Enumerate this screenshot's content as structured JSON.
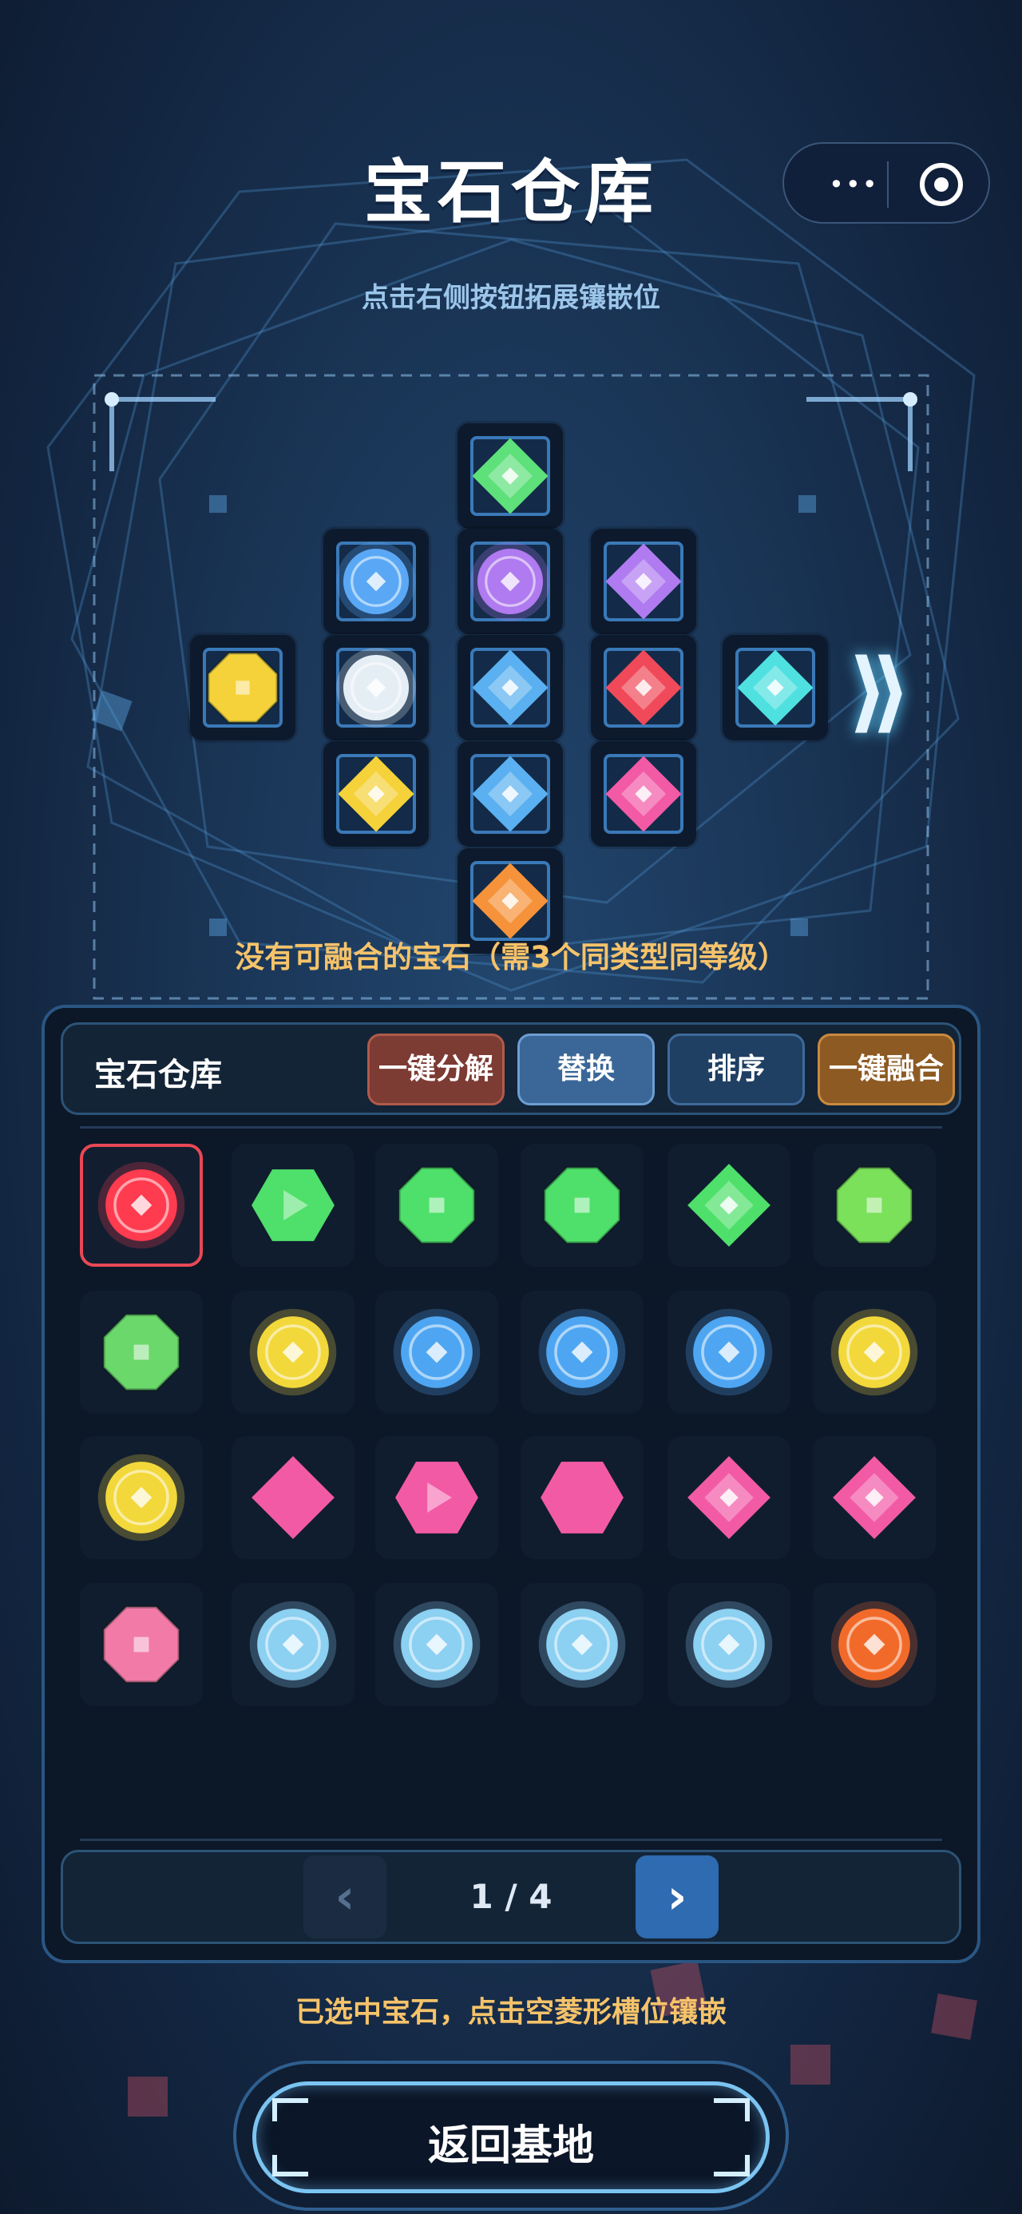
{
  "header": {
    "title": "宝石仓库",
    "menu_icon": "more-dots-icon",
    "close_icon": "target-close-icon"
  },
  "slot_area": {
    "hint": "点击右侧按钮拓展镶嵌位",
    "fusion_message": "没有可融合的宝石（需3个同类型同等级）",
    "expand_icon": "double-chevron-right-icon",
    "slots": [
      {
        "gem": "green-diamond"
      },
      {
        "gem": "blue-orb"
      },
      {
        "gem": "purple-orb"
      },
      {
        "gem": "purple-diamond"
      },
      {
        "gem": "yellow-octagon"
      },
      {
        "gem": "white-orb"
      },
      {
        "gem": "blue-diamond"
      },
      {
        "gem": "red-diamond"
      },
      {
        "gem": "cyan-diamond"
      },
      {
        "gem": "yellow-diamond"
      },
      {
        "gem": "blue-diamond"
      },
      {
        "gem": "pink-diamond"
      },
      {
        "gem": "orange-diamond"
      }
    ]
  },
  "inventory": {
    "title": "宝石仓库",
    "buttons": {
      "decompose": "一键分解",
      "replace": "替换",
      "sort": "排序",
      "fuse": "一键融合"
    },
    "gems": [
      {
        "shape": "orb",
        "color": "#ff3b4f",
        "selected": true
      },
      {
        "shape": "hexagon-play",
        "color": "#4ee06a"
      },
      {
        "shape": "octagon",
        "color": "#4ee06a"
      },
      {
        "shape": "octagon",
        "color": "#4ee06a"
      },
      {
        "shape": "diamond",
        "color": "#4ee06a"
      },
      {
        "shape": "octagon",
        "color": "#7be05a"
      },
      {
        "shape": "octagon",
        "color": "#6ad86a"
      },
      {
        "shape": "orb",
        "color": "#f2d83a"
      },
      {
        "shape": "orb",
        "color": "#4ea6f2"
      },
      {
        "shape": "orb",
        "color": "#4ea6f2"
      },
      {
        "shape": "orb",
        "color": "#4ea6f2"
      },
      {
        "shape": "orb",
        "color": "#f2d83a"
      },
      {
        "shape": "orb",
        "color": "#f2d83a"
      },
      {
        "shape": "diamond-flat",
        "color": "#f25aa6"
      },
      {
        "shape": "hexagon-play",
        "color": "#f25aa6"
      },
      {
        "shape": "hexagon",
        "color": "#f25aa6"
      },
      {
        "shape": "diamond",
        "color": "#f25aa6"
      },
      {
        "shape": "diamond",
        "color": "#f25aa6"
      },
      {
        "shape": "octagon",
        "color": "#f27aa6"
      },
      {
        "shape": "orb",
        "color": "#8cd0f2"
      },
      {
        "shape": "orb",
        "color": "#8cd0f2"
      },
      {
        "shape": "orb",
        "color": "#8cd0f2"
      },
      {
        "shape": "orb",
        "color": "#8cd0f2"
      },
      {
        "shape": "orb",
        "color": "#f26a2a"
      }
    ],
    "pager": {
      "prev_icon": "chevron-left-icon",
      "text": "1 / 4",
      "next_icon": "chevron-right-icon"
    }
  },
  "footer": {
    "selection_message": "已选中宝石，点击空菱形槽位镶嵌",
    "return_label": "返回基地"
  }
}
